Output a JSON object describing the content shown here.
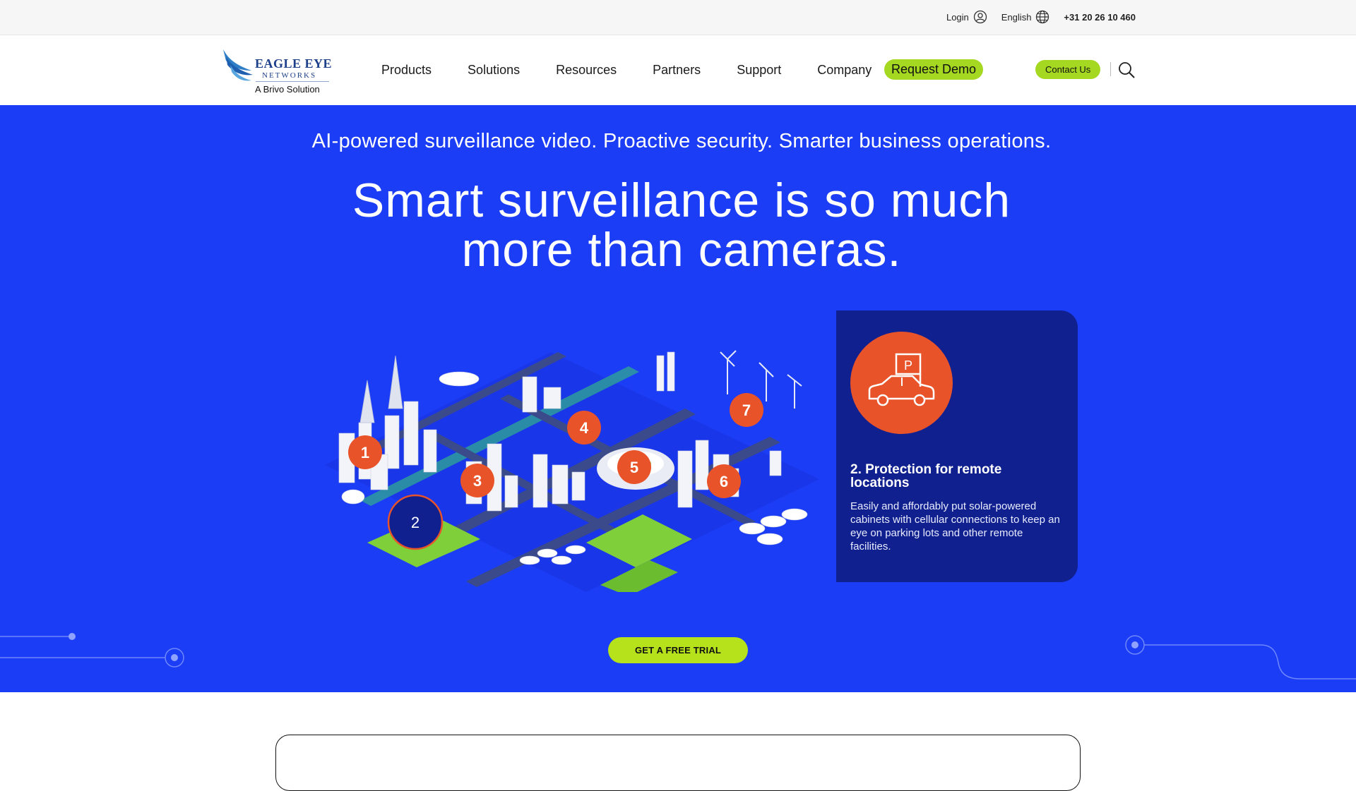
{
  "utility": {
    "login_label": "Login",
    "language_label": "English",
    "phone": "+31 20 26 10 460"
  },
  "logo": {
    "line1": "EAGLE EYE",
    "line2": "NETWORKS",
    "line3": "A Brivo Solution"
  },
  "nav": {
    "items": [
      {
        "label": "Products"
      },
      {
        "label": "Solutions"
      },
      {
        "label": "Resources"
      },
      {
        "label": "Partners"
      },
      {
        "label": "Support"
      },
      {
        "label": "Company"
      }
    ],
    "request_demo": "Request Demo",
    "contact_us": "Contact Us"
  },
  "hero": {
    "tagline": "AI-powered surveillance video. Proactive security. Smarter business operations.",
    "title_line1": "Smart surveillance is so much",
    "title_line2": "more than cameras.",
    "markers": [
      "1",
      "2",
      "3",
      "4",
      "5",
      "6",
      "7"
    ],
    "active_marker": "2",
    "card": {
      "icon": "parking-car-icon",
      "icon_letter": "P",
      "title": "2. Protection for remote locations",
      "body": "Easily and affordably put solar-powered cabinets with cellular connections to keep an eye on parking lots and other remote facilities."
    },
    "cta": "GET A FREE TRIAL"
  },
  "colors": {
    "hero_blue": "#1b3df5",
    "card_navy": "#10208f",
    "accent_green": "#a5d820",
    "marker_orange": "#e9532a"
  }
}
